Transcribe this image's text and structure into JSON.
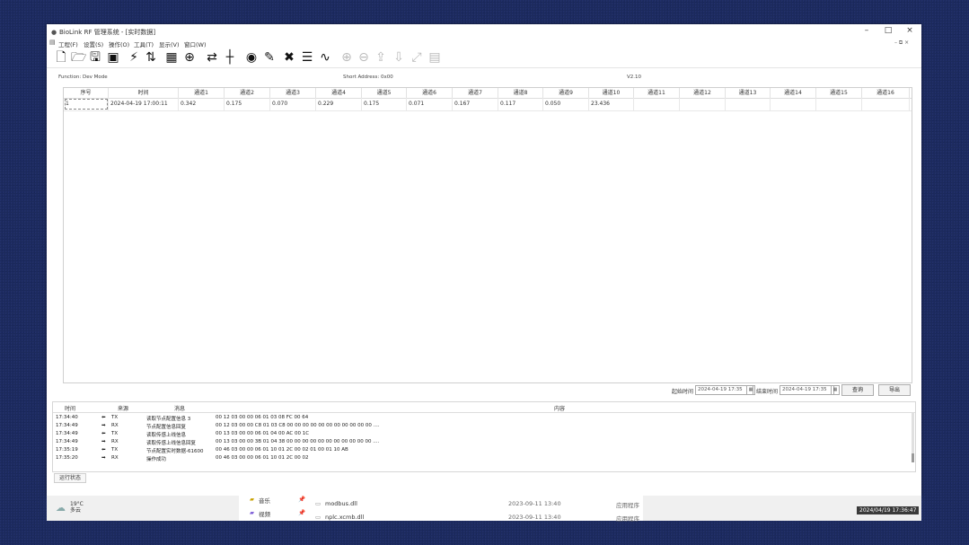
{
  "window": {
    "title": "BioLink RF 管理系统 - [实时数据]",
    "minimize": "–",
    "maximize": "□",
    "close": "×"
  },
  "menu": [
    "工程(F)",
    "设置(S)",
    "操作(O)",
    "工具(T)",
    "显示(V)",
    "窗口(W)"
  ],
  "mdi_controls": "– ⧉ ×",
  "info": {
    "function": "Function: Dev Mode",
    "short_address": "Short Address: 0x00",
    "version": "V2.10"
  },
  "grid": {
    "columns": [
      "序号",
      "时间",
      "通道1",
      "通道2",
      "通道3",
      "通道4",
      "通道5",
      "通道6",
      "通道7",
      "通道8",
      "通道9",
      "通道10",
      "通道11",
      "通道12",
      "通道13",
      "通道14",
      "通道15",
      "通道16"
    ],
    "rows": [
      [
        "1",
        "2024-04-19 17:00:11",
        "0.342",
        "0.175",
        "0.070",
        "0.229",
        "0.175",
        "0.071",
        "0.167",
        "0.117",
        "0.050",
        "23.436",
        "",
        "",
        "",
        "",
        "",
        ""
      ]
    ]
  },
  "filter": {
    "start_label": "起始时间",
    "start_value": "2024-04-19 17:35",
    "end_label": "结束时间",
    "end_value": "2024-04-19 17:35",
    "query_button": "查询",
    "export_button": "导出"
  },
  "log": {
    "headers": [
      "时间",
      "来源",
      "消息",
      "内容"
    ],
    "rows": [
      {
        "time": "17:34:40",
        "arrow": "⬅",
        "dir": "TX",
        "msg": "读取节点配置信息 3",
        "content": "00 12 03 00 00 06 01 03 08 FC 00 64"
      },
      {
        "time": "17:34:49",
        "arrow": "➡",
        "dir": "RX",
        "msg": "节点配置信息回复",
        "content": "00 12 03 00 00 C8 01 03 C8 00 00 00 00 00 00 00 00 00 00 00 ...."
      },
      {
        "time": "17:34:49",
        "arrow": "⬅",
        "dir": "TX",
        "msg": "读取传感上线信息",
        "content": "00 13 03 00 00 06 01 04 00 AC 00 1C"
      },
      {
        "time": "17:34:49",
        "arrow": "➡",
        "dir": "RX",
        "msg": "读取传感上线信息回复",
        "content": "00 13 03 00 00 3B 01 04 38 00 00 00 00 00 00 00 00 00 00 00 ...."
      },
      {
        "time": "17:35:19",
        "arrow": "⬅",
        "dir": "TX",
        "msg": "节点配置实时数据-61600",
        "content": "00 46 03 00 00 06 01 10 01 2C 00 02 01 00 01 10 AB"
      },
      {
        "time": "17:35:20",
        "arrow": "➡",
        "dir": "RX",
        "msg": "操作成功",
        "content": "00 46 03 00 00 06 01 10 01 2C 00 02"
      }
    ]
  },
  "status": {
    "tab": "运行状态"
  },
  "taskbar": {
    "weather_temp": "19°C",
    "weather_desc": "多云",
    "explorer": {
      "folder1": "音乐",
      "folder2": "视频",
      "file1": "modbus.dll",
      "file1_date": "2023-09-11 13:40",
      "file1_type": "应用程序",
      "file2": "nplc.xcmb.dll",
      "file2_date": "2023-09-11 13:40",
      "file2_type": "应用程序"
    },
    "clock": "2024/04/19 17:36:47"
  },
  "colors": {
    "desktop": "#1c2a5c",
    "window_bg": "#ffffff",
    "grid_border": "#cfcfcf"
  }
}
